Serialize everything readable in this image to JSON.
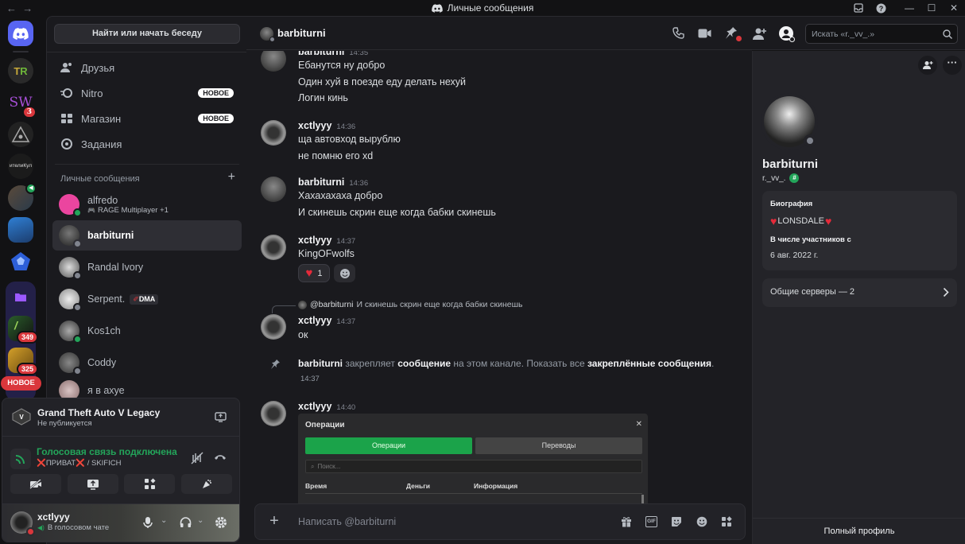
{
  "window": {
    "title": "Личные сообщения",
    "nav_back": "←",
    "nav_forward": "→"
  },
  "servers": [
    {
      "name": "TR"
    },
    {
      "name": "SW",
      "badge": "3"
    },
    {
      "name": "Illuminati"
    },
    {
      "name": "ителиКул"
    },
    {
      "name": "Speaker server"
    },
    {
      "name": "Blue server"
    },
    {
      "name": "Pentagon server"
    },
    {
      "name": "Folder"
    },
    {
      "name": "Grand Theft Auto",
      "badge": "349"
    },
    {
      "name": "Gold server",
      "badge": "325"
    }
  ],
  "rail_new_pill": "НОВОЕ",
  "sidebar": {
    "search_button": "Найти или начать беседу",
    "nav": [
      {
        "label": "Друзья",
        "icon": "friends-icon"
      },
      {
        "label": "Nitro",
        "icon": "nitro-icon",
        "pill": "НОВОЕ"
      },
      {
        "label": "Магазин",
        "icon": "shop-icon",
        "pill": "НОВОЕ"
      },
      {
        "label": "Задания",
        "icon": "quests-icon"
      }
    ],
    "dm_header": "Личные сообщения",
    "dm_add": "+",
    "dms": [
      {
        "name": "alfredo",
        "sub": "RAGE Multiplayer +1"
      },
      {
        "name": "barbiturni",
        "sub": ""
      },
      {
        "name": "Randal Ivory",
        "sub": ""
      },
      {
        "name": "Serpent.",
        "tag": "DMA",
        "sub": ""
      },
      {
        "name": "Kos1ch",
        "sub": ""
      },
      {
        "name": "Coddy",
        "sub": ""
      },
      {
        "name": "я в ахуе",
        "sub": ""
      }
    ]
  },
  "activity": {
    "game": "Grand Theft Auto V Legacy",
    "game_sub": "Не публикуется",
    "voice_status": "Голосовая связь подключена",
    "voice_channel": "❌ПРИВАТ❌ / SKIFICH"
  },
  "user": {
    "name": "xctlyyy",
    "status": "В голосовом чате"
  },
  "chat_header": {
    "name": "barbiturni",
    "search_placeholder": "Искать «r._vv_.»"
  },
  "messages": [
    {
      "author": "barbiturni",
      "time": "14:35",
      "lines": [
        "Ебанутся ну добро",
        "Один хуй в поезде еду делать нехуй",
        "Логин кинь"
      ]
    },
    {
      "author": "xctlyyy",
      "time": "14:36",
      "lines": [
        "ща автовход вырублю",
        "не помню его xd"
      ]
    },
    {
      "author": "barbiturni",
      "time": "14:36",
      "lines": [
        "Хахахахаха добро",
        "И скинешь скрин еще когда бабки скинешь"
      ]
    },
    {
      "author": "xctlyyy",
      "time": "14:37",
      "lines": [
        "KingOFwolfs"
      ],
      "reaction_count": "1"
    },
    {
      "author": "xctlyyy",
      "time": "14:37",
      "lines": [
        "ок"
      ],
      "reply_to": "@barbiturni",
      "reply_text": "И скинешь скрин еще когда бабки скинешь"
    },
    {
      "author": "xctlyyy",
      "time": "14:40",
      "lines": []
    }
  ],
  "pin_notice": {
    "actor": "barbiturni",
    "text1": "закрепляет",
    "link1": "сообщение",
    "text2": "на этом канале. Показать все",
    "link2": "закреплённые сообщения",
    "dot": ".",
    "time": "14:37"
  },
  "embed": {
    "title": "Операции",
    "close": "✕",
    "tab_active": "Операции",
    "tab_inactive": "Переводы",
    "search_placeholder": "Поиск...",
    "columns": [
      "Время",
      "Деньги",
      "Информация"
    ]
  },
  "composer": {
    "placeholder": "Написать @barbiturni"
  },
  "profile": {
    "name": "barbiturni",
    "username": "r._vv_.",
    "bio_title": "Биография",
    "bio_text": "LONSDALE",
    "member_title": "В числе участников с",
    "member_date": "6 авг. 2022 г.",
    "mutual": "Общие серверы — 2",
    "full_profile": "Полный профиль"
  },
  "colors": {
    "accent": "#5865f2",
    "green": "#23a55a",
    "red": "#da373c",
    "voice_green": "#23a55a"
  }
}
